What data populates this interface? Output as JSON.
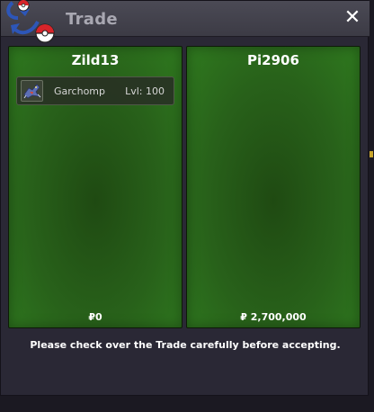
{
  "window": {
    "title": "Trade",
    "close_symbol": "✕"
  },
  "left_panel": {
    "player": "Zild13",
    "money": "₽0",
    "items": [
      {
        "icon": "garchomp-sprite-icon",
        "name": "Garchomp",
        "level": "Lvl: 100"
      }
    ]
  },
  "right_panel": {
    "player": "Pi2906",
    "money": "₽ 2,700,000",
    "items": []
  },
  "footer": {
    "note": "Please check over the Trade carefully before accepting."
  },
  "colors": {
    "panel_green": "#2f7a1f",
    "title_text": "#a9a8b2",
    "pokeball_red": "#d8242a",
    "logo_blue": "#2d56b8"
  }
}
